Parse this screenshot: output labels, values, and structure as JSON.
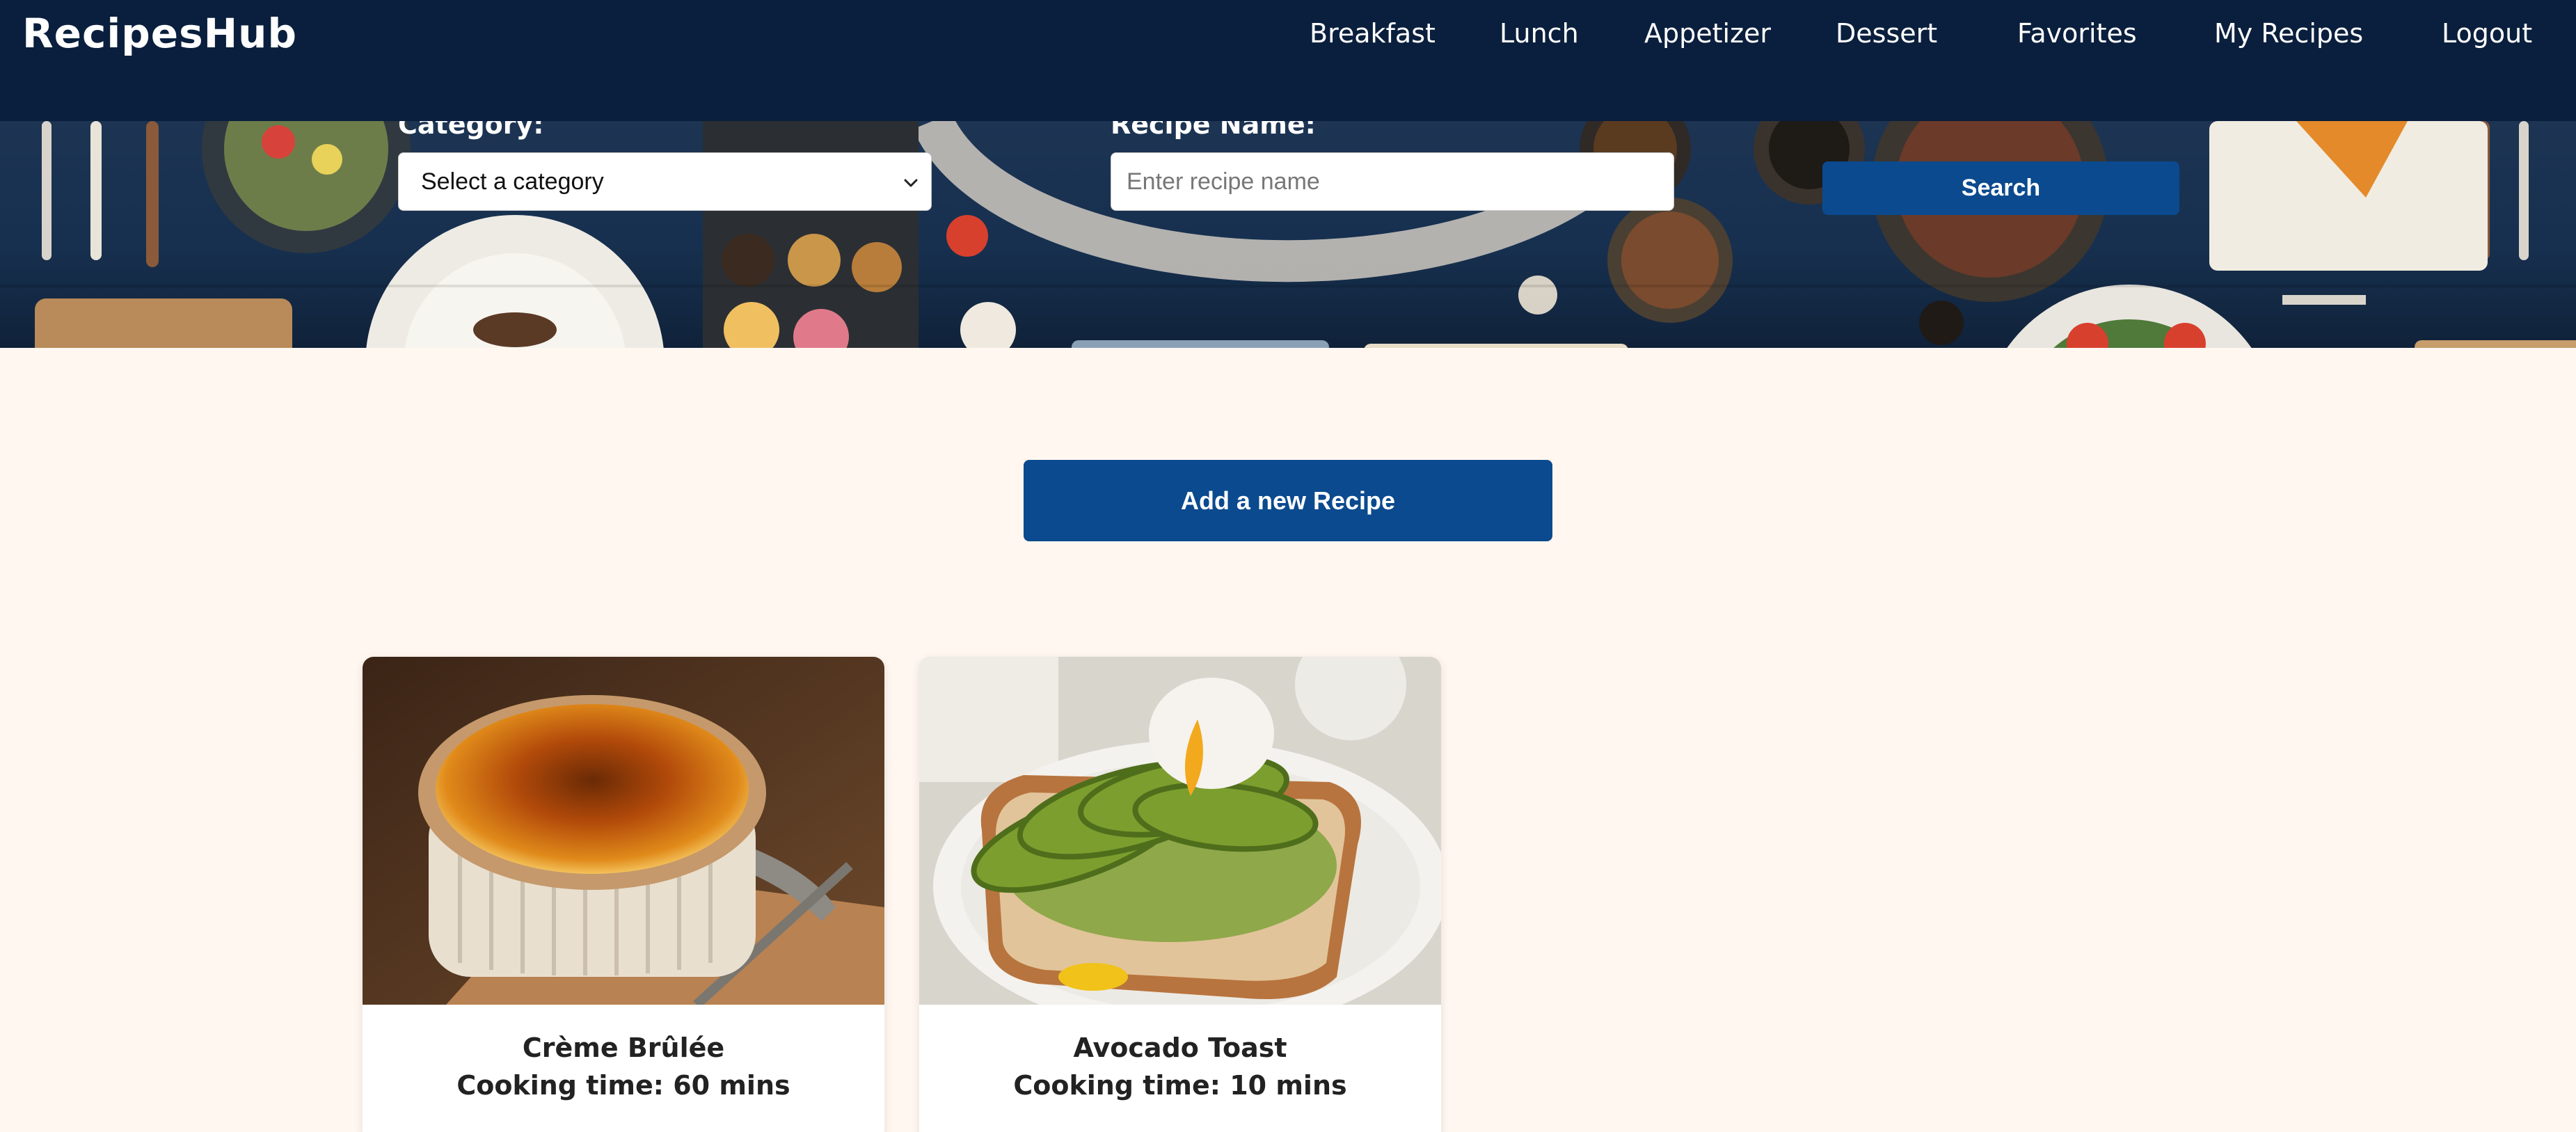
{
  "header": {
    "brand": "RecipesHub",
    "nav": [
      "Breakfast",
      "Lunch",
      "Appetizer",
      "Dessert",
      "Favorites",
      "My Recipes",
      "Logout"
    ]
  },
  "search": {
    "category_label": "Category:",
    "category_value": "Select a category",
    "name_label": "Recipe Name:",
    "name_placeholder": "Enter recipe name",
    "button": "Search"
  },
  "main": {
    "add_button": "Add a new Recipe"
  },
  "recipes": [
    {
      "title": "Crème Brûlée",
      "time": "Cooking time: 60 mins"
    },
    {
      "title": "Avocado Toast",
      "time": "Cooking time: 10 mins"
    }
  ],
  "colors": {
    "header_bg": "#0a1f3d",
    "accent": "#0b4a8e",
    "page_bg": "#fff7f0"
  }
}
